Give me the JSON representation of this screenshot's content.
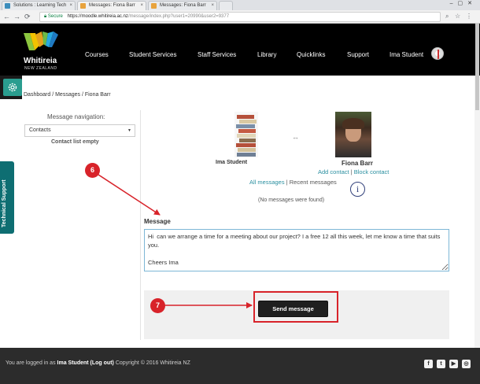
{
  "browser": {
    "tabs": [
      {
        "title": "Solutions : Learning Tech"
      },
      {
        "title": "Messages: Fiona Barr"
      },
      {
        "title": "Messages: Fiona Barr"
      }
    ],
    "secure_label": "Secure",
    "url_host": "https://moodle.whitireia.ac.nz",
    "url_rest": "/message/index.php?user1=20990&user2=9377"
  },
  "header": {
    "logo_name": "Whitireia",
    "logo_sub": "NEW ZEALAND",
    "nav": [
      "Courses",
      "Student Services",
      "Staff Services",
      "Library",
      "Quicklinks",
      "Support"
    ],
    "user_name": "Ima Student"
  },
  "breadcrumb": [
    "Dashboard",
    "Messages",
    "Fiona Barr"
  ],
  "sidebar": {
    "tech_support": "Technical Support",
    "nav_label": "Message navigation:",
    "contacts_selected": "Contacts",
    "contact_list_empty": "Contact list empty"
  },
  "conversation": {
    "me_name": "Ima Student",
    "other_name": "Fiona Barr",
    "add_contact": "Add contact",
    "separator": "|",
    "block_contact": "Block contact",
    "all_messages": "All messages",
    "recent_messages": "Recent messages",
    "no_messages": "(No messages were found)",
    "info_icon_glyph": "i",
    "swap_glyph": "↔"
  },
  "form": {
    "message_label": "Message",
    "message_text": "Hi  can we arrange a time for a meeting about our project? I a free 12 all this week, let me know a time that suits you.\n\nCheers Ima",
    "send_label": "Send message"
  },
  "annotations": {
    "step6": "6",
    "step7": "7",
    "color": "#d8232a"
  },
  "footer": {
    "logged_in_prefix": "You are logged in as",
    "user": "Ima Student",
    "logout": "(Log out)",
    "copyright": "Copyright © 2016 Whitireia NZ"
  },
  "colors": {
    "header_bg": "#000000",
    "accent": "#2a8fa0",
    "tech_support_bg": "#0e6e72",
    "footer_bg": "#2c2c2c"
  }
}
